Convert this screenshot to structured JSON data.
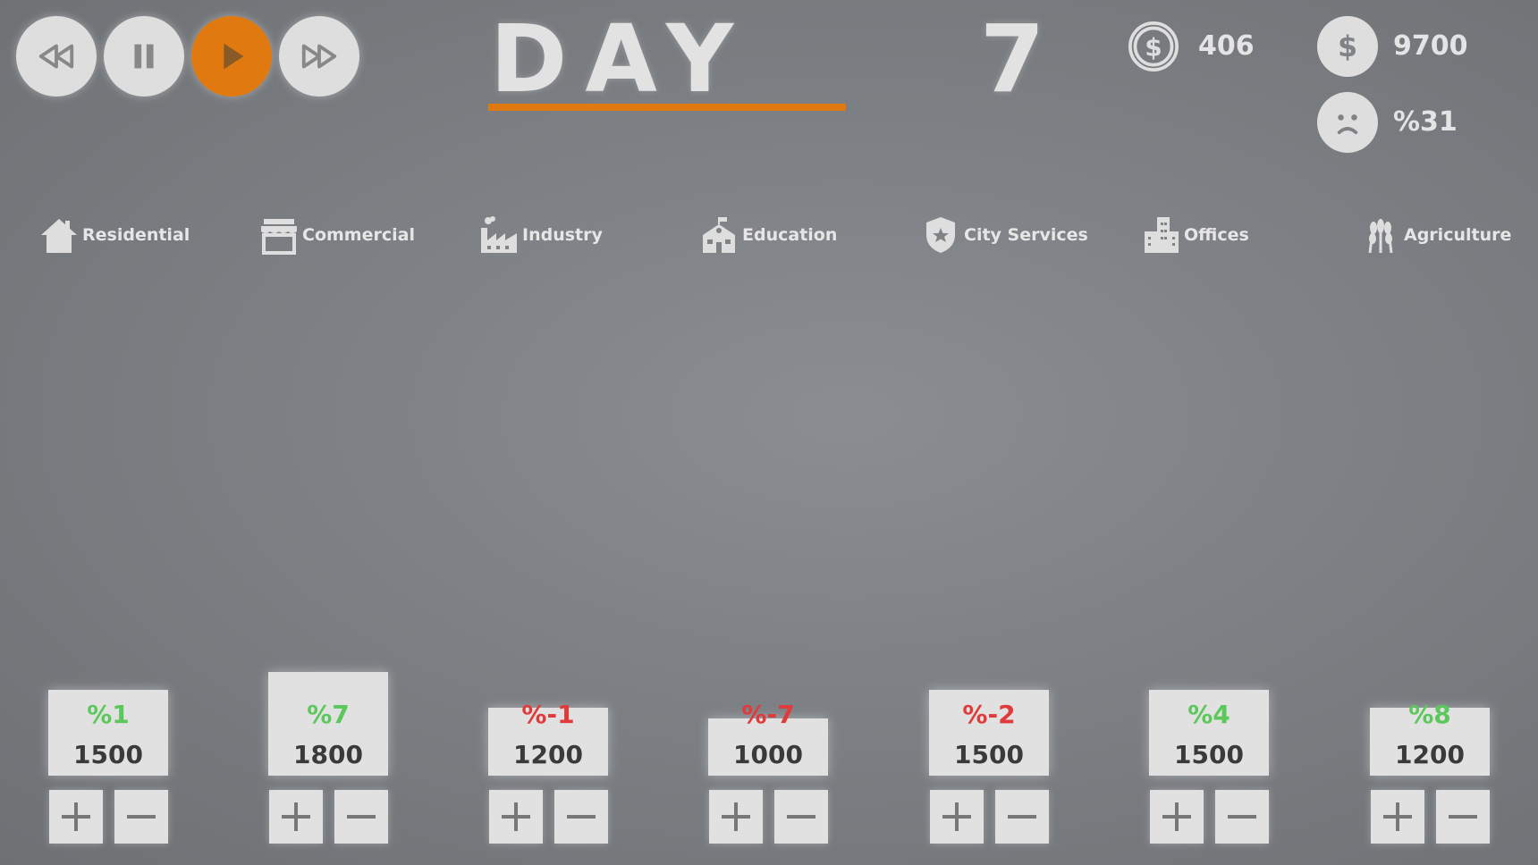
{
  "controls": [
    {
      "name": "rewind-button",
      "icon": "rewind-icon",
      "active": false
    },
    {
      "name": "pause-button",
      "icon": "pause-icon",
      "active": false
    },
    {
      "name": "play-button",
      "icon": "play-icon",
      "active": true
    },
    {
      "name": "fast-forward-button",
      "icon": "fast-forward-icon",
      "active": false
    }
  ],
  "day": {
    "label": "DAY",
    "number": "7"
  },
  "stats": {
    "income": {
      "icon": "coin-icon",
      "value": "406"
    },
    "money": {
      "icon": "dollar-icon",
      "value": "9700"
    },
    "happiness": {
      "icon": "sad-face-icon",
      "value": "%31"
    }
  },
  "categories": [
    {
      "label": "Residential",
      "icon": "house-icon"
    },
    {
      "label": "Commercial",
      "icon": "shop-icon"
    },
    {
      "label": "Industry",
      "icon": "factory-icon"
    },
    {
      "label": "Education",
      "icon": "school-icon"
    },
    {
      "label": "City Services",
      "icon": "police-badge-icon"
    },
    {
      "label": "Offices",
      "icon": "office-building-icon"
    },
    {
      "label": "Agriculture",
      "icon": "wheat-icon"
    }
  ],
  "budgets": [
    {
      "category": "Residential",
      "change": "%1",
      "value": "1500",
      "trend": "up"
    },
    {
      "category": "Commercial",
      "change": "%7",
      "value": "1800",
      "trend": "up"
    },
    {
      "category": "Industry",
      "change": "%-1",
      "value": "1200",
      "trend": "down"
    },
    {
      "category": "Education",
      "change": "%-7",
      "value": "1000",
      "trend": "down"
    },
    {
      "category": "City Services",
      "change": "%-2",
      "value": "1500",
      "trend": "down"
    },
    {
      "category": "Offices",
      "change": "%4",
      "value": "1500",
      "trend": "up"
    },
    {
      "category": "Agriculture",
      "change": "%8",
      "value": "1200",
      "trend": "up"
    }
  ],
  "buttons": {
    "plus": "+",
    "minus": "−"
  },
  "colors": {
    "accent": "#e07a10",
    "positive": "#5cc85c",
    "negative": "#e03a3a",
    "panel": "#e1e1e1",
    "icon": "#dedede",
    "text_dark": "#3a3a3a"
  }
}
